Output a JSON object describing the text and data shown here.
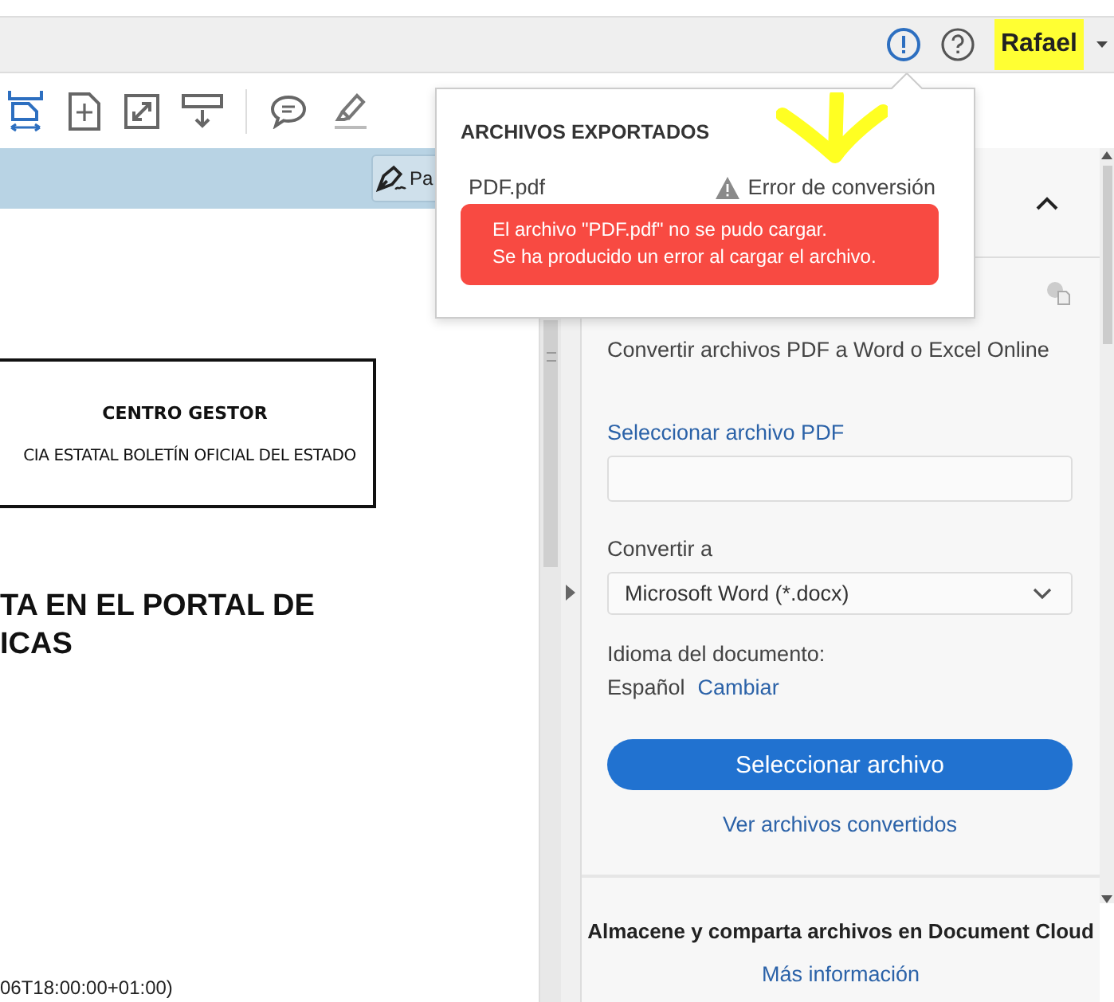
{
  "top_bar": {
    "user_name": "Rafael"
  },
  "document_bar": {
    "button_label": "Pa"
  },
  "document": {
    "box_title": "CENTRO GESTOR",
    "box_text": "CIA ESTATAL BOLETÍN OFICIAL DEL ESTADO",
    "heading_lines": [
      "TA EN EL PORTAL DE",
      "ICAS"
    ],
    "footer_text": "06T18:00:00+01:00)"
  },
  "exported_popup": {
    "title": "ARCHIVOS EXPORTADOS",
    "file_name": "PDF.pdf",
    "status": "Error de conversión",
    "error_lines": [
      "El archivo \"PDF.pdf\" no se pudo cargar.",
      "Se ha producido un error al cargar el archivo."
    ]
  },
  "export_panel": {
    "expanded": true,
    "description": "Convertir archivos PDF a Word o Excel Online",
    "select_label": "Seleccionar archivo PDF",
    "convert_label": "Convertir a",
    "format": "Microsoft Word (*.docx)",
    "language_label": "Idioma del documento:",
    "language": "Español",
    "change_link": "Cambiar",
    "primary_button": "Seleccionar archivo",
    "converted_link": "Ver archivos convertidos"
  },
  "cloud_promo": {
    "text": "Almacene y comparta archivos en Document Cloud",
    "link": "Más información"
  }
}
